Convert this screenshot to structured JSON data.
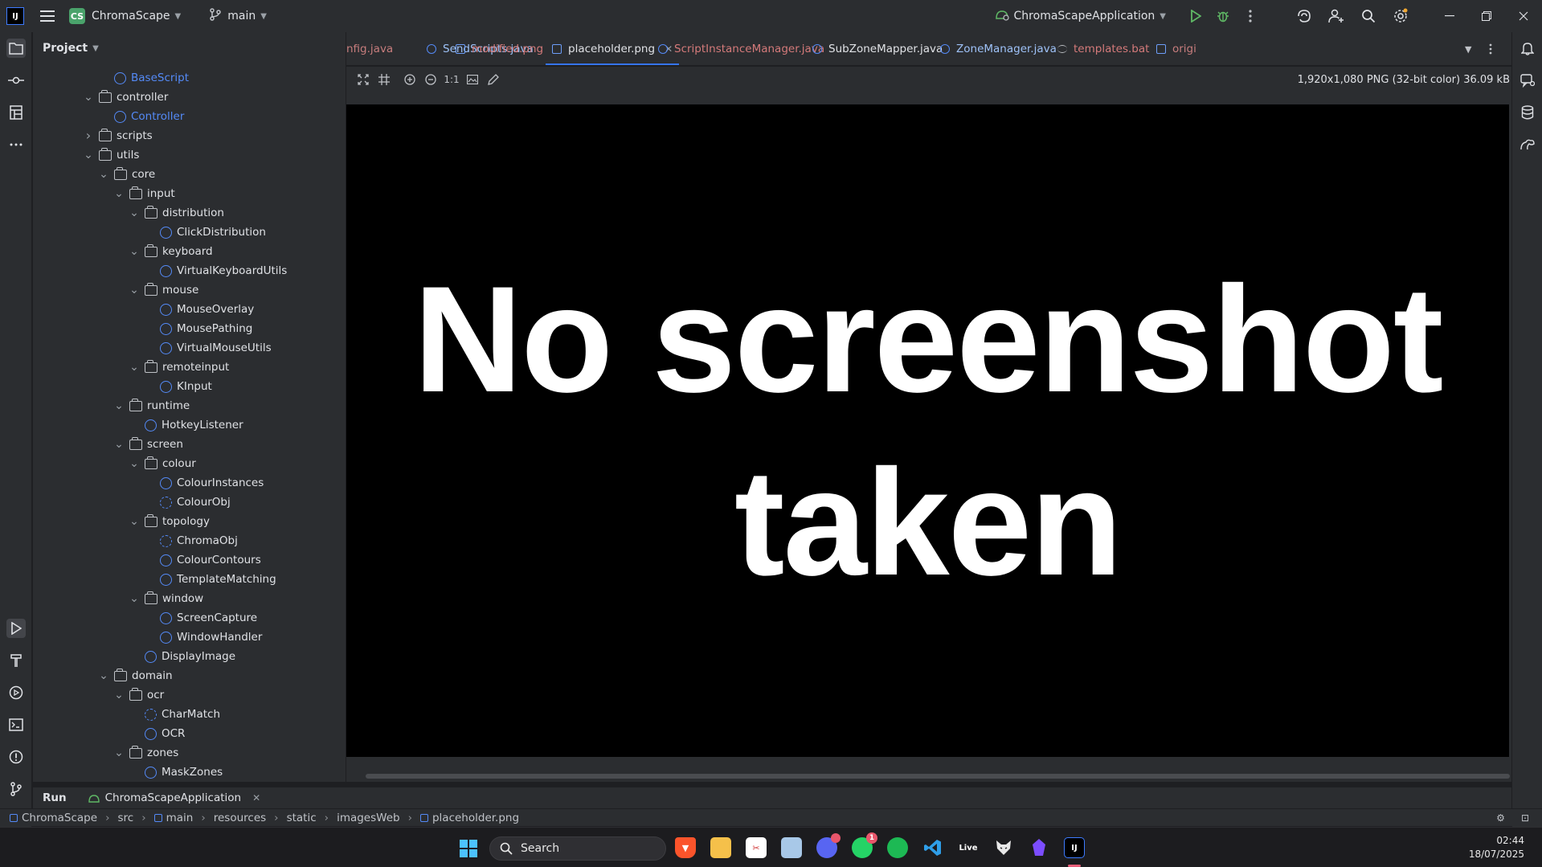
{
  "titlebar": {
    "logo": "IJ",
    "project_badge": "CS",
    "project_name": "ChromaScape",
    "branch": "main",
    "run_config": "ChromaScapeApplication"
  },
  "project_pane": {
    "title": "Project",
    "tree": [
      {
        "label": "BaseScript",
        "type": "class",
        "depth": 5,
        "expanded": null,
        "blue": true
      },
      {
        "label": "controller",
        "type": "folder",
        "depth": 4,
        "expanded": true
      },
      {
        "label": "Controller",
        "type": "class",
        "depth": 5,
        "expanded": null,
        "blue": true
      },
      {
        "label": "scripts",
        "type": "folder",
        "depth": 4,
        "expanded": false
      },
      {
        "label": "utils",
        "type": "folder",
        "depth": 4,
        "expanded": true
      },
      {
        "label": "core",
        "type": "folder",
        "depth": 5,
        "expanded": true
      },
      {
        "label": "input",
        "type": "folder",
        "depth": 6,
        "expanded": true
      },
      {
        "label": "distribution",
        "type": "folder",
        "depth": 7,
        "expanded": true
      },
      {
        "label": "ClickDistribution",
        "type": "class",
        "depth": 8
      },
      {
        "label": "keyboard",
        "type": "folder",
        "depth": 7,
        "expanded": true
      },
      {
        "label": "VirtualKeyboardUtils",
        "type": "class",
        "depth": 8
      },
      {
        "label": "mouse",
        "type": "folder",
        "depth": 7,
        "expanded": true
      },
      {
        "label": "MouseOverlay",
        "type": "class",
        "depth": 8
      },
      {
        "label": "MousePathing",
        "type": "class",
        "depth": 8
      },
      {
        "label": "VirtualMouseUtils",
        "type": "class",
        "depth": 8
      },
      {
        "label": "remoteinput",
        "type": "folder",
        "depth": 7,
        "expanded": true
      },
      {
        "label": "KInput",
        "type": "class",
        "depth": 8
      },
      {
        "label": "runtime",
        "type": "folder",
        "depth": 6,
        "expanded": true
      },
      {
        "label": "HotkeyListener",
        "type": "class",
        "depth": 7
      },
      {
        "label": "screen",
        "type": "folder",
        "depth": 6,
        "expanded": true
      },
      {
        "label": "colour",
        "type": "folder",
        "depth": 7,
        "expanded": true
      },
      {
        "label": "ColourInstances",
        "type": "class",
        "depth": 8
      },
      {
        "label": "ColourObj",
        "type": "record",
        "depth": 8
      },
      {
        "label": "topology",
        "type": "folder",
        "depth": 7,
        "expanded": true
      },
      {
        "label": "ChromaObj",
        "type": "record",
        "depth": 8
      },
      {
        "label": "ColourContours",
        "type": "class",
        "depth": 8
      },
      {
        "label": "TemplateMatching",
        "type": "class",
        "depth": 8
      },
      {
        "label": "window",
        "type": "folder",
        "depth": 7,
        "expanded": true
      },
      {
        "label": "ScreenCapture",
        "type": "class",
        "depth": 8
      },
      {
        "label": "WindowHandler",
        "type": "class",
        "depth": 8
      },
      {
        "label": "DisplayImage",
        "type": "class",
        "depth": 7
      },
      {
        "label": "domain",
        "type": "folder",
        "depth": 5,
        "expanded": true
      },
      {
        "label": "ocr",
        "type": "folder",
        "depth": 6,
        "expanded": true
      },
      {
        "label": "CharMatch",
        "type": "record",
        "depth": 7
      },
      {
        "label": "OCR",
        "type": "class",
        "depth": 7
      },
      {
        "label": "zones",
        "type": "folder",
        "depth": 6,
        "expanded": true
      },
      {
        "label": "MaskZones",
        "type": "class",
        "depth": 7
      }
    ]
  },
  "tabs": [
    {
      "label": "nfig.java",
      "icon": "none",
      "active": false
    },
    {
      "label": "SendScripts.java",
      "icon": "class",
      "active": false
    },
    {
      "label": "modified.png",
      "icon": "image",
      "active": false
    },
    {
      "label": "placeholder.png",
      "icon": "image",
      "active": true
    },
    {
      "label": "ScriptInstanceManager.java",
      "icon": "class",
      "active": false
    },
    {
      "label": "SubZoneMapper.java",
      "icon": "class",
      "active": false
    },
    {
      "label": "ZoneManager.java",
      "icon": "class",
      "active": false
    },
    {
      "label": "templates.bat",
      "icon": "text",
      "active": false
    },
    {
      "label": "origi",
      "icon": "image",
      "active": false
    }
  ],
  "image_toolbar": {
    "actual_size_label": "1:1",
    "info": "1,920x1,080 PNG (32-bit color) 36.09 kB"
  },
  "image_content": {
    "line1": "No screenshot",
    "line2": "taken"
  },
  "runbar": {
    "run_label": "Run",
    "config_tab": "ChromaScapeApplication"
  },
  "breadcrumb": [
    "ChromaScape",
    "src",
    "main",
    "resources",
    "static",
    "imagesWeb",
    "placeholder.png"
  ],
  "taskbar": {
    "search_placeholder": "Search",
    "time": "02:44",
    "date": "18/07/2025",
    "discord_badge": "",
    "whatsapp_badge": "1",
    "live_label": "Live"
  },
  "colors": {
    "accent": "#3574f0",
    "class_icon": "#548af7",
    "bg_panel": "#2b2d30",
    "bg_dark": "#1e1f22"
  }
}
